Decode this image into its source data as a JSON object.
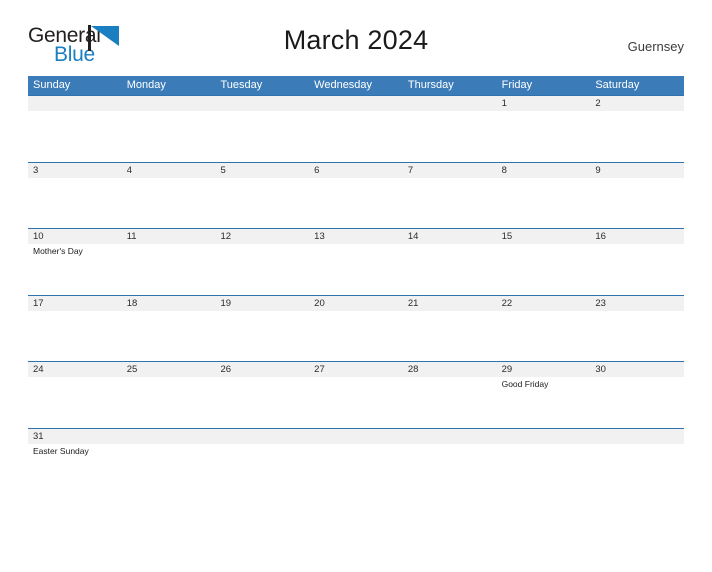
{
  "brand": {
    "word_one": "General",
    "word_two": "Blue",
    "word_one_color": "#231f20",
    "word_two_color": "#1a7fc1",
    "sail_color": "#1a7fc1",
    "logo_icon": "sailboat-flag-icon"
  },
  "header": {
    "title": "March 2024",
    "region": "Guernsey"
  },
  "theme": {
    "header_blue": "#3b7cb8",
    "separator_blue": "#2f72b0",
    "band_gray": "#f1f1f1",
    "page_background": "#ffffff",
    "text_color": "#1c1c1c"
  },
  "calendar": {
    "month": "March",
    "year": "2024",
    "weekday_headers": [
      "Sunday",
      "Monday",
      "Tuesday",
      "Wednesday",
      "Thursday",
      "Friday",
      "Saturday"
    ],
    "weeks": [
      {
        "days": [
          {
            "date": "",
            "events": []
          },
          {
            "date": "",
            "events": []
          },
          {
            "date": "",
            "events": []
          },
          {
            "date": "",
            "events": []
          },
          {
            "date": "",
            "events": []
          },
          {
            "date": "1",
            "events": []
          },
          {
            "date": "2",
            "events": []
          }
        ]
      },
      {
        "days": [
          {
            "date": "3",
            "events": []
          },
          {
            "date": "4",
            "events": []
          },
          {
            "date": "5",
            "events": []
          },
          {
            "date": "6",
            "events": []
          },
          {
            "date": "7",
            "events": []
          },
          {
            "date": "8",
            "events": []
          },
          {
            "date": "9",
            "events": []
          }
        ]
      },
      {
        "days": [
          {
            "date": "10",
            "events": [
              "Mother's Day"
            ]
          },
          {
            "date": "11",
            "events": []
          },
          {
            "date": "12",
            "events": []
          },
          {
            "date": "13",
            "events": []
          },
          {
            "date": "14",
            "events": []
          },
          {
            "date": "15",
            "events": []
          },
          {
            "date": "16",
            "events": []
          }
        ]
      },
      {
        "days": [
          {
            "date": "17",
            "events": []
          },
          {
            "date": "18",
            "events": []
          },
          {
            "date": "19",
            "events": []
          },
          {
            "date": "20",
            "events": []
          },
          {
            "date": "21",
            "events": []
          },
          {
            "date": "22",
            "events": []
          },
          {
            "date": "23",
            "events": []
          }
        ]
      },
      {
        "days": [
          {
            "date": "24",
            "events": []
          },
          {
            "date": "25",
            "events": []
          },
          {
            "date": "26",
            "events": []
          },
          {
            "date": "27",
            "events": []
          },
          {
            "date": "28",
            "events": []
          },
          {
            "date": "29",
            "events": [
              "Good Friday"
            ]
          },
          {
            "date": "30",
            "events": []
          }
        ]
      },
      {
        "days": [
          {
            "date": "31",
            "events": [
              "Easter Sunday"
            ]
          },
          {
            "date": "",
            "events": []
          },
          {
            "date": "",
            "events": []
          },
          {
            "date": "",
            "events": []
          },
          {
            "date": "",
            "events": []
          },
          {
            "date": "",
            "events": []
          },
          {
            "date": "",
            "events": []
          }
        ]
      }
    ]
  }
}
